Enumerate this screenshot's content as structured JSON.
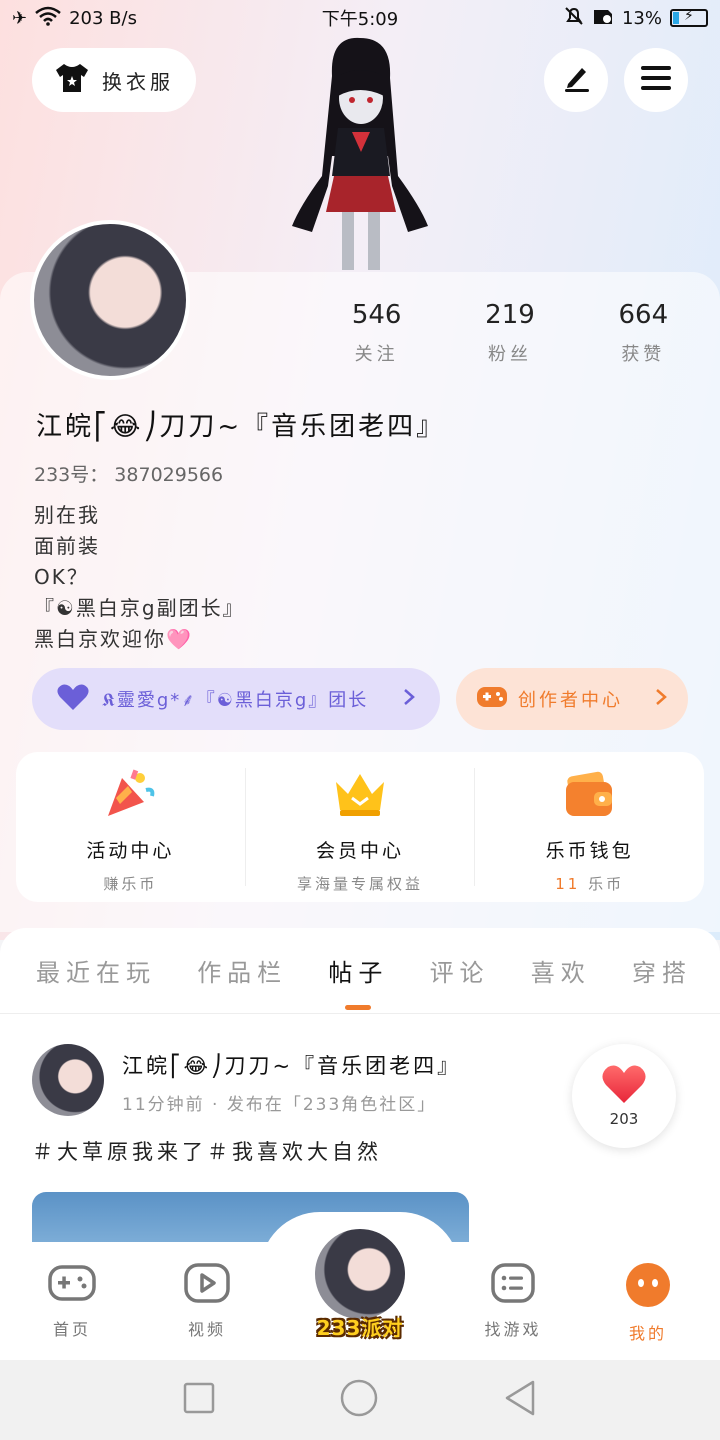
{
  "status_bar": {
    "net_speed": "203 B/s",
    "time": "下午5:09",
    "battery": "13%"
  },
  "top": {
    "outfit_label": "换衣服"
  },
  "profile": {
    "stats": [
      {
        "value": "546",
        "label": "关注"
      },
      {
        "value": "219",
        "label": "粉丝"
      },
      {
        "value": "664",
        "label": "获赞"
      }
    ],
    "nickname": "江皖⎡😂⎠刀刀~『音乐团老四』",
    "uid": "233号： 387029566",
    "bio": [
      "别在我",
      "面前装",
      "OK？",
      "『☯黑白京g副团长』",
      "黑白京欢迎你🩷"
    ]
  },
  "badges": {
    "guild": "𝕶靈愛g*⸙『☯黑白京g』团长",
    "creator": "创作者中心"
  },
  "services": [
    {
      "title": "活动中心",
      "sub": "赚乐币"
    },
    {
      "title": "会员中心",
      "sub": "享海量专属权益"
    },
    {
      "title": "乐币钱包",
      "sub_value": "11",
      "sub_unit": "乐币"
    }
  ],
  "tabs": [
    "最近在玩",
    "作品栏",
    "帖子",
    "评论",
    "喜欢",
    "穿搭"
  ],
  "active_tab": "帖子",
  "post": {
    "author": "江皖⎡😂⎠刀刀~『音乐团老四』",
    "meta": "11分钟前 · 发布在「233角色社区」",
    "text": "＃大草原我来了＃我喜欢大自然",
    "likes": "203"
  },
  "bottom_nav": [
    {
      "label": "首页",
      "icon": "gamepad-icon"
    },
    {
      "label": "视频",
      "icon": "play-icon"
    },
    {
      "brand": "233派对",
      "icon": "party-avatar"
    },
    {
      "label": "找游戏",
      "icon": "list-icon"
    },
    {
      "label": "我的",
      "icon": "profile-dots-icon"
    }
  ],
  "colors": {
    "accent": "#f07b2c",
    "guild_purple": "#6b5fd8"
  }
}
